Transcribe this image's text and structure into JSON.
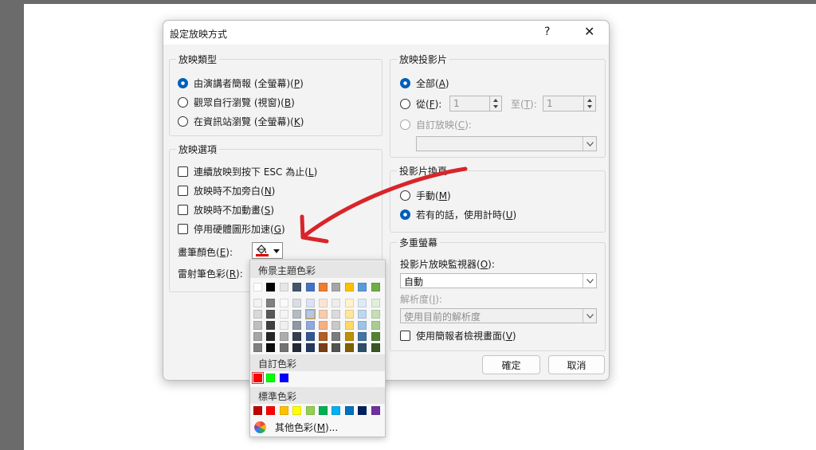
{
  "dialog": {
    "title": "設定放映方式",
    "help": "?",
    "close": "✕"
  },
  "show_type": {
    "label": "放映類型",
    "options": [
      {
        "text": "由演講者簡報 (全螢幕)(",
        "key": "P",
        "end": ")",
        "selected": true
      },
      {
        "text": "觀眾自行瀏覽 (視窗)(",
        "key": "B",
        "end": ")",
        "selected": false
      },
      {
        "text": "在資訊站瀏覽 (全螢幕)(",
        "key": "K",
        "end": ")",
        "selected": false
      }
    ]
  },
  "show_options": {
    "label": "放映選項",
    "checks": [
      {
        "text": "連續放映到按下 ESC 為止(",
        "key": "L",
        "end": ")"
      },
      {
        "text": "放映時不加旁白(",
        "key": "N",
        "end": ")"
      },
      {
        "text": "放映時不加動畫(",
        "key": "S",
        "end": ")"
      },
      {
        "text": "停用硬體圖形加速(",
        "key": "G",
        "end": ")"
      }
    ],
    "pen_color": {
      "text": "畫筆顏色(",
      "key": "E",
      "end": "):",
      "value_color": "#e00000"
    },
    "laser_color": {
      "text": "雷射筆色彩(",
      "key": "R",
      "end": "):"
    }
  },
  "show_slides": {
    "label": "放映投影片",
    "all": {
      "text": "全部(",
      "key": "A",
      "end": ")"
    },
    "from": {
      "text": "從(",
      "key": "F",
      "end": "):",
      "value": "1"
    },
    "to": {
      "text": "至(",
      "key": "T",
      "end": "):",
      "value": "1"
    },
    "custom": {
      "text": "自訂放映(",
      "key": "C",
      "end": "):"
    }
  },
  "advance": {
    "label": "投影片換頁",
    "manual": {
      "text": "手動(",
      "key": "M",
      "end": ")"
    },
    "timings": {
      "text": "若有的話，使用計時(",
      "key": "U",
      "end": ")"
    }
  },
  "multi_monitor": {
    "label": "多重螢幕",
    "monitor_label": {
      "text": "投影片放映監視器(",
      "key": "O",
      "end": "):"
    },
    "monitor_value": "自動",
    "resolution_label": {
      "text": "解析度(",
      "key": "I",
      "end": "):"
    },
    "resolution_value": "使用目前的解析度",
    "presenter_view": {
      "text": "使用簡報者檢視畫面(",
      "key": "V",
      "end": ")"
    }
  },
  "buttons": {
    "ok": "確定",
    "cancel": "取消"
  },
  "palette": {
    "theme_label": "佈景主題色彩",
    "theme_colors": [
      "#ffffff",
      "#000000",
      "#e7e6e6",
      "#44546a",
      "#4472c4",
      "#ed7d31",
      "#a5a5a5",
      "#ffc000",
      "#5b9bd5",
      "#70ad47"
    ],
    "custom_label": "自訂色彩",
    "custom_colors": [
      "#ff0000",
      "#00ff00",
      "#0000ff"
    ],
    "standard_label": "標準色彩",
    "standard_colors": [
      "#c00000",
      "#ff0000",
      "#ffc000",
      "#ffff00",
      "#92d050",
      "#00b050",
      "#00b0f0",
      "#0070c0",
      "#002060",
      "#7030a0"
    ],
    "more": {
      "text": "其他色彩(",
      "key": "M",
      "end": ")..."
    }
  },
  "annotation": {
    "arrow_color": "#d9252a"
  }
}
